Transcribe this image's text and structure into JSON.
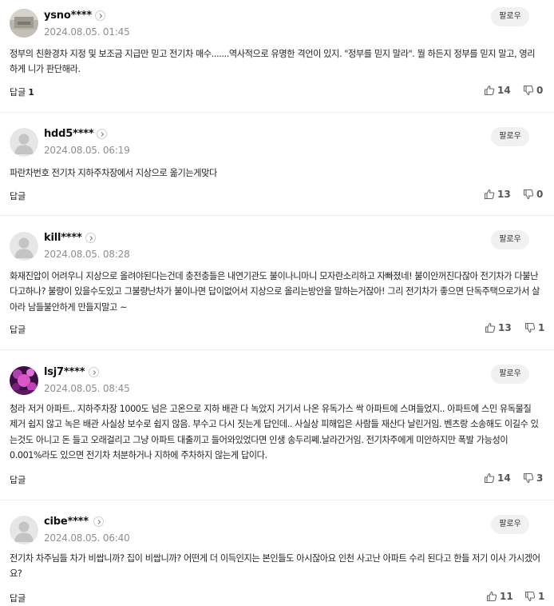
{
  "comments": [
    {
      "nickname": "ysno****",
      "date": "2024.08.05. 01:45",
      "follow_label": "팔로우",
      "body": "정부의 친환경차 지정 및 보조금 지급만 믿고 전기차 매수.......역사적으로 유명한 격언이 있지. \"정부를 믿지 말라\". 뭘 하든지 정부를 믿지 말고, 영리하게 니가 판단해라.",
      "reply_label": "답글",
      "reply_count": "1",
      "likes": "14",
      "dislikes": "0",
      "avatar": "blurry-photo"
    },
    {
      "nickname": "hdd5****",
      "date": "2024.08.05. 06:19",
      "follow_label": "팔로우",
      "body": "파란차번호 전기차 지하주차장에서 지상으로 옮기는게맞다",
      "reply_label": "답글",
      "reply_count": "",
      "likes": "13",
      "dislikes": "0",
      "avatar": "default"
    },
    {
      "nickname": "kill****",
      "date": "2024.08.05. 08:28",
      "follow_label": "팔로우",
      "body": "화재진압이 어려우니 지상으로 올려야된다는건데 충전충들은 내연기관도 불이나니마니 모자란소리하고 자빠졌네! 불이안꺼진다잖아 전기차가 다불난다고하나? 불량이 있을수도있고 그불량난차가 불이나면 답이없어서 지상으로 올리는방안을 말하는거잖아! 그리 전기차가 좋으면 단독주택으로가서 살아라 남들불안하게 만들지말고 ~",
      "reply_label": "답글",
      "reply_count": "",
      "likes": "13",
      "dislikes": "1",
      "avatar": "default"
    },
    {
      "nickname": "lsj7****",
      "date": "2024.08.05. 08:45",
      "follow_label": "팔로우",
      "body": "청라 저거 아파트.. 지하주차장 1000도 넘은 고온으로 지하 배관 다 녹았지 거기서 나온 유독가스 싹 아파트에 스며들었지.. 아파트에 스민 유독물질 제거 쉽지 않고 녹은 배관 사실상 보수로 쉽지 않음. 부수고 다시 짓는게 답인데.. 사실상 피해입은 사람들 재산다 날린거임. 벤츠랑 소송해도 이길수 있는것도 아니고 돈 들고 오래걸리고 그냥 아파트 대출끼고 들어와있었다면 인생 송두리쩨.날라간거임. 전기차주에게 미안하지만 폭발 가능성이 0.001%라도 있으면 전기차 처분하거나 지하에 주차하지 않는게 답이다.",
      "reply_label": "답글",
      "reply_count": "",
      "likes": "14",
      "dislikes": "3",
      "avatar": "purple-photo"
    },
    {
      "nickname": "cibe****",
      "date": "2024.08.05. 06:40",
      "follow_label": "팔로우",
      "body": "전기차 차주님들 차가 비쌉니까? 집이 비쌉니까? 어떤게 더 이득인지는 본인들도 아시잖아요 인천 사고난 아파트 수리 된다고 한들 저기 이사 가시겠어요?",
      "reply_label": "답글",
      "reply_count": "",
      "likes": "11",
      "dislikes": "1",
      "avatar": "default"
    }
  ],
  "icons": {
    "like": "thumb-up-icon",
    "dislike": "thumb-down-icon",
    "profile": "chevron-right-icon"
  }
}
